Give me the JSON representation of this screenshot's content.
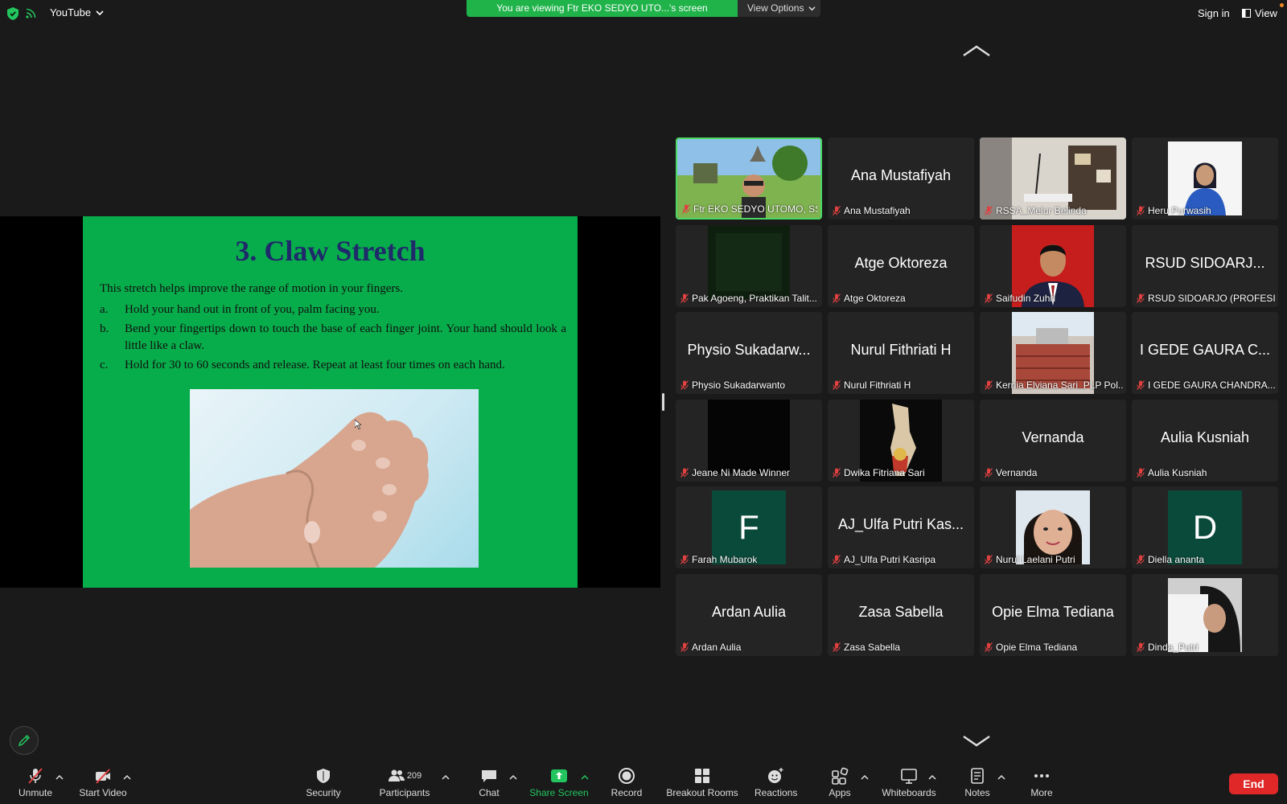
{
  "topbar": {
    "app_name": "YouTube",
    "viewing_banner": "You are viewing Ftr EKO SEDYO UTO...'s screen",
    "view_options": "View Options",
    "sign_in": "Sign in",
    "view": "View"
  },
  "slide": {
    "title": "3. Claw Stretch",
    "intro": "This stretch helps improve the range of motion in your fingers.",
    "items": [
      {
        "letter": "a.",
        "text": "Hold your hand out in front of you, palm facing you."
      },
      {
        "letter": "b.",
        "text": "Bend your fingertips down to touch the base of each finger joint. Your hand should look a little like a claw."
      },
      {
        "letter": "c.",
        "text": "Hold for 30 to 60 seconds and release. Repeat at least four times on each hand."
      }
    ]
  },
  "participants": [
    {
      "label": "Ftr EKO SEDYO UTOMO, SST",
      "big": "",
      "kind": "photo-landscape",
      "active": true
    },
    {
      "label": "Ana Mustafiyah",
      "big": "Ana Mustafiyah",
      "kind": "name"
    },
    {
      "label": "RSSA_Melur Belinda",
      "big": "",
      "kind": "photo-room"
    },
    {
      "label": "Heru Purwasih",
      "big": "",
      "kind": "photo-portrait-blue"
    },
    {
      "label": "Pak Agoeng, Praktikan Talit...",
      "big": "",
      "kind": "photo-dark-green"
    },
    {
      "label": "Atge Oktoreza",
      "big": "Atge Oktoreza",
      "kind": "name"
    },
    {
      "label": "Saifudin Zuhri",
      "big": "",
      "kind": "photo-portrait-red"
    },
    {
      "label": "RSUD SIDOARJO (PROFESI...",
      "big": "RSUD SIDOARJ...",
      "kind": "name"
    },
    {
      "label": "Physio Sukadarwanto",
      "big": "Physio Sukadarw...",
      "kind": "name"
    },
    {
      "label": "Nurul Fithriati H",
      "big": "Nurul Fithriati H",
      "kind": "name"
    },
    {
      "label": "Kernia Elviana Sari_PLP Pol...",
      "big": "",
      "kind": "photo-building"
    },
    {
      "label": "I GEDE GAURA CHANDRA...",
      "big": "I GEDE GAURA C...",
      "kind": "name"
    },
    {
      "label": "Jeane Ni Made Winner",
      "big": "",
      "kind": "photo-black"
    },
    {
      "label": "Dwika Fitriana Sari",
      "big": "",
      "kind": "photo-map"
    },
    {
      "label": "Vernanda",
      "big": "Vernanda",
      "kind": "name"
    },
    {
      "label": "Aulia Kusniah",
      "big": "Aulia Kusniah",
      "kind": "name"
    },
    {
      "label": "Farah Mubarok",
      "big": "F",
      "kind": "letter"
    },
    {
      "label": "AJ_Ulfa Putri Kasripa",
      "big": "AJ_Ulfa Putri Kas...",
      "kind": "name"
    },
    {
      "label": "Nurul Laelani Putri",
      "big": "",
      "kind": "photo-face"
    },
    {
      "label": "Diella ananta",
      "big": "D",
      "kind": "letter"
    },
    {
      "label": "Ardan Aulia",
      "big": "Ardan Aulia",
      "kind": "name"
    },
    {
      "label": "Zasa Sabella",
      "big": "Zasa Sabella",
      "kind": "name"
    },
    {
      "label": "Opie Elma Tediana",
      "big": "Opie Elma Tediana",
      "kind": "name"
    },
    {
      "label": "Dinda_Putri",
      "big": "",
      "kind": "photo-hijab"
    }
  ],
  "toolbar": {
    "unmute": "Unmute",
    "start_video": "Start Video",
    "security": "Security",
    "participants": "Participants",
    "participants_count": "209",
    "chat": "Chat",
    "share_screen": "Share Screen",
    "record": "Record",
    "breakout_rooms": "Breakout Rooms",
    "reactions": "Reactions",
    "apps": "Apps",
    "whiteboards": "Whiteboards",
    "notes": "Notes",
    "more": "More",
    "end": "End"
  },
  "colors": {
    "share_green": "#1fb34a",
    "slide_green": "#08ad4b",
    "active_border": "#4cd964",
    "end_red": "#e02828",
    "muted_red": "#e04040"
  }
}
